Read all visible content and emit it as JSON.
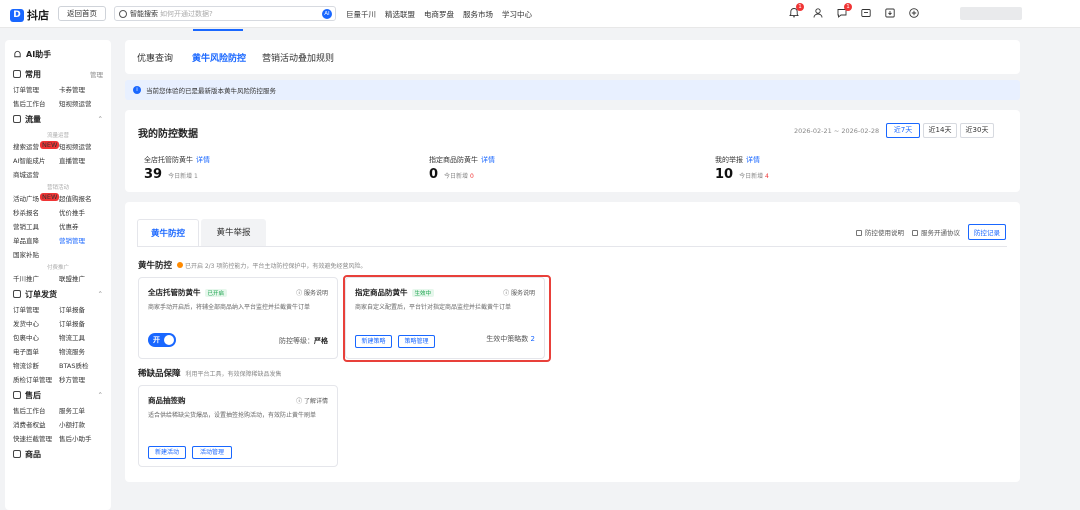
{
  "topbar": {
    "logo_text": "抖店",
    "back_label": "返回首页",
    "search_strong": "智能搜索",
    "search_placeholder": "如何开通过数据?",
    "search_ai": "AI",
    "nav": [
      "巨量千川",
      "精选联盟",
      "电商罗盘",
      "服务市场",
      "学习中心"
    ],
    "icons": [
      {
        "name": "bell-icon",
        "badge": "1"
      },
      {
        "name": "user-icon",
        "badge": ""
      },
      {
        "name": "chat-icon",
        "badge": "1"
      },
      {
        "name": "message-icon",
        "badge": ""
      },
      {
        "name": "download-icon",
        "badge": ""
      },
      {
        "name": "plus-circle-icon",
        "badge": ""
      }
    ]
  },
  "sidebar": {
    "ai_label": "AI助手",
    "sections": [
      {
        "title": "常用",
        "right": "管理",
        "items": [
          [
            "订单管理",
            "卡券管理"
          ],
          [
            "售后工作台",
            "短视频运营"
          ]
        ]
      },
      {
        "title": "流量",
        "right": "",
        "groups": [
          {
            "caption": "流量运营",
            "items": [
              [
                "搜索运营",
                "短视频运营"
              ],
              [
                "AI智能成片",
                "直播管理"
              ],
              [
                "商城运营",
                ""
              ]
            ]
          },
          {
            "caption": "营销活动",
            "items": [
              [
                "活动广场",
                "超值购报名"
              ],
              [
                "秒杀报名",
                "优价推手"
              ],
              [
                "营销工具",
                "优惠券"
              ],
              [
                "单品直降",
                "营销管理"
              ],
              [
                "国家补贴",
                ""
              ]
            ]
          },
          {
            "caption": "付费推广",
            "items": [
              [
                "千川推广",
                "联盟推广"
              ]
            ]
          }
        ]
      },
      {
        "title": "订单发货",
        "right": "",
        "items": [
          [
            "订单管理",
            "订单报备"
          ],
          [
            "发货中心",
            "订单报备"
          ],
          [
            "包裹中心",
            "物流工具"
          ],
          [
            "电子面单",
            "物流服务"
          ],
          [
            "物流诊断",
            "BTAS质检"
          ],
          [
            "质检订单管理",
            "秒方管理"
          ]
        ]
      },
      {
        "title": "售后",
        "right": "",
        "items": [
          [
            "售后工作台",
            "服务工单"
          ],
          [
            "消费者权益",
            "小额打款"
          ],
          [
            "快速拦截管理",
            "售后小助手"
          ]
        ]
      },
      {
        "title": "商品",
        "right": "",
        "items": []
      }
    ],
    "new_badge": "NEW",
    "active_item": "营销管理"
  },
  "tabs": [
    "优惠查询",
    "黄牛风险防控",
    "营销活动叠加规则"
  ],
  "notice": "当前您体验的已是最新版本黄牛风险防控服务",
  "data_panel": {
    "title": "我的防控数据",
    "date_range": "2026-02-21 ~ 2026-02-28",
    "range_buttons": [
      "近7天",
      "近14天",
      "近30天"
    ],
    "metrics": [
      {
        "label": "全店托管防黄牛",
        "link": "详情",
        "value": "39",
        "inc_label": "今日新增",
        "inc": "1",
        "inc_red": false
      },
      {
        "label": "指定商品防黄牛",
        "link": "详情",
        "value": "0",
        "inc_label": "今日新增",
        "inc": "0",
        "inc_red": true
      },
      {
        "label": "我的举报",
        "link": "详情",
        "value": "10",
        "inc_label": "今日新增",
        "inc": "4",
        "inc_red": true
      }
    ]
  },
  "protection": {
    "subtabs": [
      "黄牛防控",
      "黄牛举报"
    ],
    "right_links": [
      "防控使用说明",
      "服务开通协议"
    ],
    "record_label": "防控记录",
    "section1_title": "黄牛防控",
    "section1_desc": "已开启 2/3 项防控能力，平台主动防控保护中，有效避免经营风险。",
    "card1": {
      "title": "全店托管防黄牛",
      "tag": "已开启",
      "help": "服务说明",
      "desc": "商家手动开启后，将辅全部商品纳入平台监控并拦截黄牛订单",
      "toggle": "开",
      "level_label": "防控等级：",
      "level": "严格"
    },
    "card2": {
      "title": "指定商品防黄牛",
      "tag": "生效中",
      "help": "服务说明",
      "desc": "商家自定义配置后，平台针对指定商品监控并拦截黄牛订单",
      "btn1": "新建策略",
      "btn2": "策略管理",
      "effective_label": "生效中策略数",
      "effective": "2"
    },
    "section2_title": "稀缺品保障",
    "section2_desc": "利用平台工具，有效保障稀缺品发售",
    "card3": {
      "title": "商品抽签购",
      "help": "了解详情",
      "desc": "适合供给稀缺尖货爆品，设置抽签抢购活动，有效防止黄牛刷单",
      "btn1": "新建活动",
      "btn2": "活动管理"
    }
  }
}
